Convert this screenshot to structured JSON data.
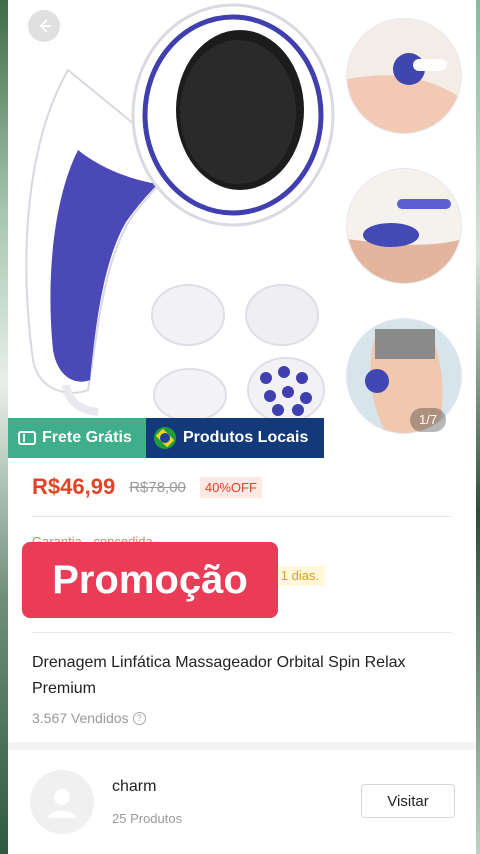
{
  "product": {
    "image_alt": "Orbital spin massager device with interchangeable heads",
    "page_indicator": "1/7",
    "badges": {
      "frete": "Frete Grátis",
      "local": "Produtos Locais"
    },
    "price": "R$46,99",
    "old_price": "R$78,00",
    "discount": "40%OFF",
    "guarantee_text": "Garantia - concedida",
    "delivery_highlight": "n 1 dias.",
    "promo_banner": "Promoção",
    "title": "Drenagem Linfática Massageador Orbital Spin Relax Premium",
    "sold": "3.567 Vendidos",
    "help": "?"
  },
  "shop": {
    "name": "charm",
    "products": "25 Produtos",
    "visit_label": "Visitar"
  },
  "colors": {
    "price_red": "#e24326",
    "frete_green": "#3fae8a",
    "local_blue": "#123a7a",
    "promo_pink": "#ea3b57"
  },
  "icons": {
    "back": "arrow-left-icon",
    "ticket": "ticket-icon",
    "flag": "brazil-flag-icon",
    "help": "question-circle-icon",
    "avatar": "user-avatar-icon"
  }
}
